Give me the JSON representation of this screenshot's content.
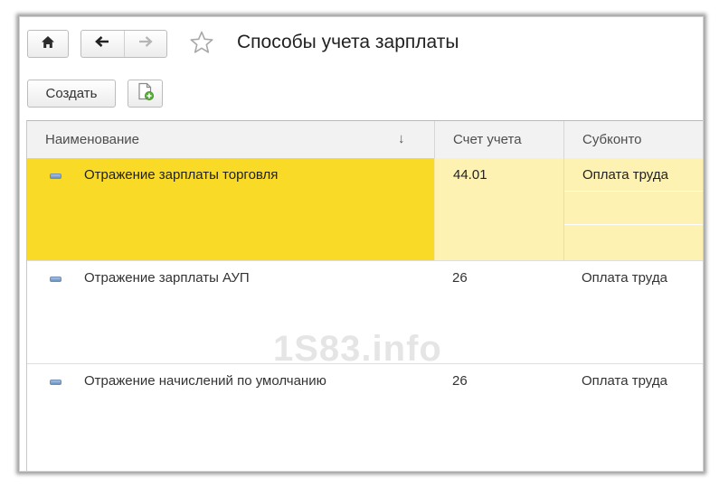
{
  "header": {
    "title": "Способы учета зарплаты",
    "home_icon": "home-icon",
    "back_icon": "arrow-left-icon",
    "forward_icon": "arrow-right-icon",
    "favorite_icon": "star-icon"
  },
  "toolbar": {
    "create_label": "Создать",
    "copy_icon": "document-add-icon"
  },
  "table": {
    "columns": [
      {
        "label": "Наименование",
        "sort_icon": "↓"
      },
      {
        "label": "Счет учета"
      },
      {
        "label": "Субконто"
      }
    ],
    "rows": [
      {
        "name": "Отражение зарплаты торговля",
        "account": "44.01",
        "subconto": "Оплата труда",
        "selected": true
      },
      {
        "name": "Отражение зарплаты АУП",
        "account": "26",
        "subconto": "Оплата труда",
        "selected": false
      },
      {
        "name": "Отражение начислений по умолчанию",
        "account": "26",
        "subconto": "Оплата труда",
        "selected": false
      }
    ]
  },
  "watermark": "1S83.info",
  "colors": {
    "selected_row": "#f9da27",
    "selected_row_light": "#fdf2b2",
    "header_bg": "#f2f2f2"
  }
}
